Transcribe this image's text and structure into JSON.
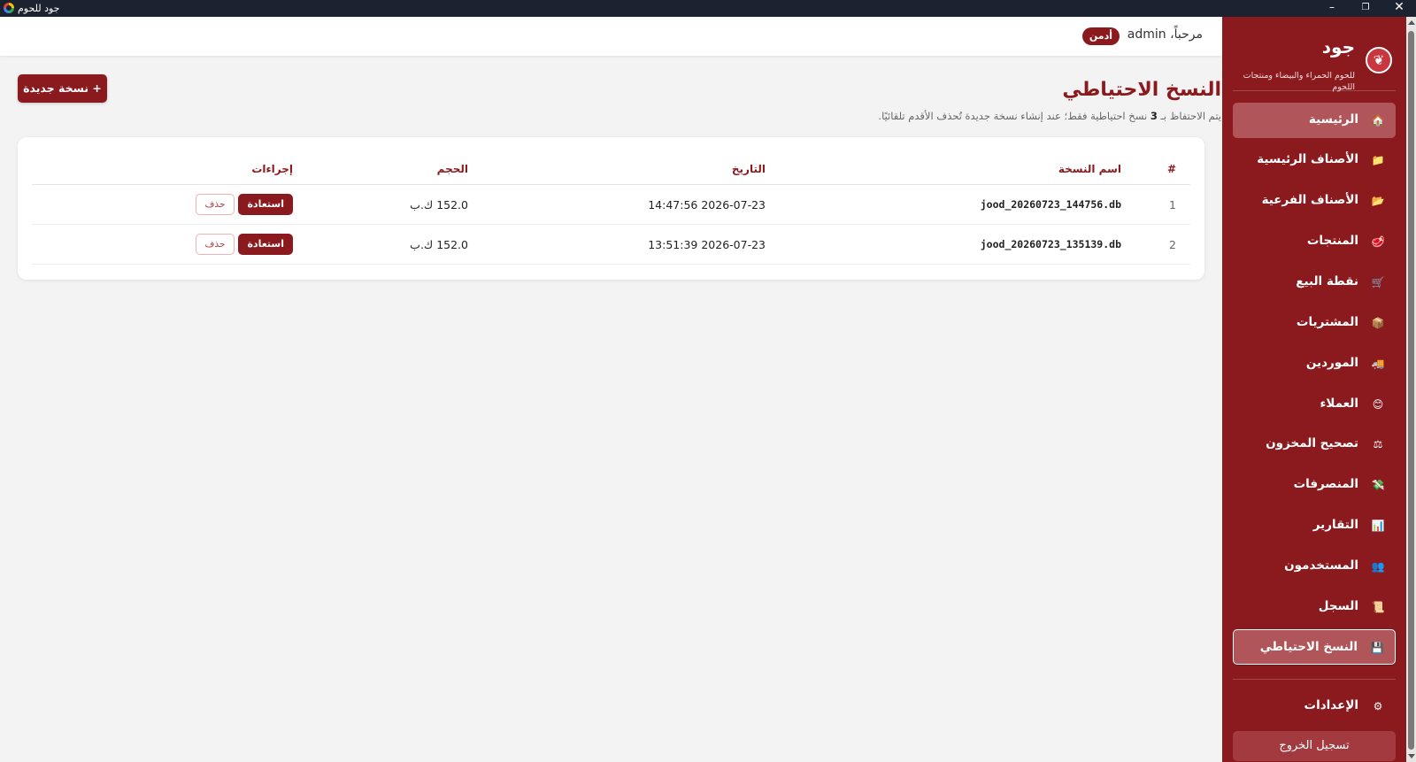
{
  "window": {
    "title": "جود للحوم",
    "minimize": "–",
    "maximize": "❐",
    "close": "✕"
  },
  "brand": {
    "name": "جود",
    "tagline": "للحوم الحمراء والبيضاء ومنتجات اللحوم",
    "logo_glyph": "❦"
  },
  "sidebar": {
    "items": [
      {
        "label": "الرئيسية",
        "icon": "house-icon",
        "glyph": "🏠"
      },
      {
        "label": "الأصناف الرئيسية",
        "icon": "folder-icon",
        "glyph": "📁"
      },
      {
        "label": "الأصناف الفرعية",
        "icon": "folder-open-icon",
        "glyph": "📂"
      },
      {
        "label": "المنتجات",
        "icon": "meat-icon",
        "glyph": "🥩"
      },
      {
        "label": "نقطة البيع",
        "icon": "cart-icon",
        "glyph": "🛒"
      },
      {
        "label": "المشتريات",
        "icon": "package-icon",
        "glyph": "📦"
      },
      {
        "label": "الموردين",
        "icon": "truck-icon",
        "glyph": "🚚"
      },
      {
        "label": "العملاء",
        "icon": "customer-icon",
        "glyph": "😊"
      },
      {
        "label": "تصحيح المخزون",
        "icon": "scale-icon",
        "glyph": "⚖"
      },
      {
        "label": "المنصرفات",
        "icon": "money-icon",
        "glyph": "💸"
      },
      {
        "label": "التقارير",
        "icon": "chart-icon",
        "glyph": "📊"
      },
      {
        "label": "المستخدمون",
        "icon": "users-icon",
        "glyph": "👥"
      },
      {
        "label": "السجل",
        "icon": "scroll-icon",
        "glyph": "📜"
      },
      {
        "label": "النسخ الاحتياطي",
        "icon": "floppy-icon",
        "glyph": "💾"
      }
    ],
    "settings": {
      "label": "الإعدادات",
      "icon": "gear-icon",
      "glyph": "⚙"
    },
    "logout_label": "تسجيل الخروج"
  },
  "header": {
    "greeting": "مرحباً، admin",
    "role_badge": "أدمن"
  },
  "page": {
    "title": "النسخ الاحتياطي",
    "desc_prefix": "يتم الاحتفاظ بـ",
    "desc_count": "3",
    "desc_suffix": "نسخ احتياطية فقط؛ عند إنشاء نسخة جديدة تُحذف الأقدم تلقائيًا.",
    "new_button": "+ نسخة جديدة"
  },
  "table": {
    "headers": {
      "num": "#",
      "name": "اسم النسخة",
      "date": "التاريخ",
      "size": "الحجم",
      "actions": "إجراءات"
    },
    "rows": [
      {
        "num": "1",
        "name": "jood_20260723_144756.db",
        "date": "2026-07-23 14:47:56",
        "size": "152.0 ك.ب",
        "restore": "استعادة",
        "delete": "حذف"
      },
      {
        "num": "2",
        "name": "jood_20260723_135139.db",
        "date": "2026-07-23 13:51:39",
        "size": "152.0 ك.ب",
        "restore": "استعادة",
        "delete": "حذف"
      }
    ]
  },
  "colors": {
    "brand": "#8b1a1f",
    "sidebar_active": "#b05559",
    "page_bg": "#f3f3f3"
  }
}
